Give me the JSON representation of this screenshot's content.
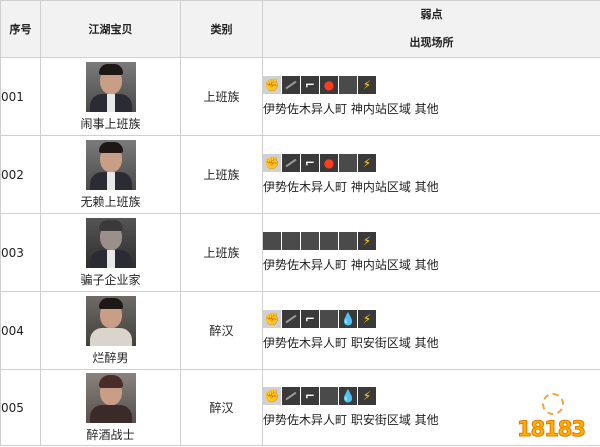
{
  "headers": {
    "id": "序号",
    "treasure": "江湖宝贝",
    "category": "类别",
    "weakness": "弱点",
    "location": "出现场所"
  },
  "rows": [
    {
      "id": "001",
      "name": "闹事上班族",
      "category": "上班族",
      "icons": [
        "fist-icon",
        "blade-icon",
        "gun-icon",
        "fire-icon",
        "blank-icon",
        "lightning-icon"
      ],
      "location": "伊势佐木异人町 神内站区域 其他"
    },
    {
      "id": "002",
      "name": "无赖上班族",
      "category": "上班族",
      "icons": [
        "fist-icon",
        "blade-icon",
        "gun-icon",
        "fire-icon",
        "blank-icon",
        "lightning-icon"
      ],
      "location": "伊势佐木异人町 神内站区域 其他"
    },
    {
      "id": "003",
      "name": "骗子企业家",
      "category": "上班族",
      "icons": [
        "blank-icon",
        "blank-icon",
        "blank-icon",
        "blank-icon",
        "blank-icon",
        "lightning-icon"
      ],
      "location": "伊势佐木异人町 神内站区域 其他"
    },
    {
      "id": "004",
      "name": "烂醉男",
      "category": "醉汉",
      "icons": [
        "fist-icon",
        "blade-icon",
        "gun-icon",
        "blank-icon",
        "water-icon",
        "lightning-icon"
      ],
      "location": "伊势佐木异人町 职安街区域 其他"
    },
    {
      "id": "005",
      "name": "醉酒战士",
      "category": "醉汉",
      "icons": [
        "fist-icon",
        "blade-icon",
        "gun-icon",
        "blank-icon",
        "water-icon",
        "lightning-icon"
      ],
      "location": "伊势佐木异人町 职安街区域 其他"
    }
  ],
  "watermark": {
    "text": "18183"
  },
  "icon_colors": {
    "fire": "#ff3b1f",
    "water": "#2fa7ff",
    "lightning": "#ffd21c",
    "tile": "#3a3a3a"
  }
}
